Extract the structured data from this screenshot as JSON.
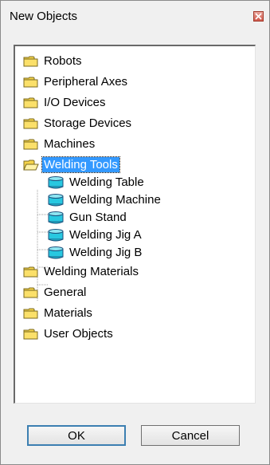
{
  "window": {
    "title": "New Objects",
    "close_icon": "close-icon",
    "accent_close": "#d0574a"
  },
  "tree": {
    "folders": [
      {
        "label": "Robots",
        "icon": "folder-closed-icon"
      },
      {
        "label": "Peripheral Axes",
        "icon": "folder-closed-icon"
      },
      {
        "label": "I/O Devices",
        "icon": "folder-closed-icon"
      },
      {
        "label": "Storage Devices",
        "icon": "folder-closed-icon"
      },
      {
        "label": "Machines",
        "icon": "folder-closed-icon"
      },
      {
        "label": "Welding Tools",
        "icon": "folder-open-icon",
        "selected": true,
        "children": [
          {
            "label": "Welding Table",
            "icon": "object-cylinder-icon"
          },
          {
            "label": "Welding Machine",
            "icon": "object-cylinder-icon"
          },
          {
            "label": "Gun Stand",
            "icon": "object-cylinder-icon"
          },
          {
            "label": "Welding Jig A",
            "icon": "object-cylinder-icon"
          },
          {
            "label": "Welding Jig B",
            "icon": "object-cylinder-icon"
          }
        ]
      },
      {
        "label": "Welding Materials",
        "icon": "folder-closed-icon"
      },
      {
        "label": "General",
        "icon": "folder-closed-icon"
      },
      {
        "label": "Materials",
        "icon": "folder-closed-icon"
      },
      {
        "label": "User Objects",
        "icon": "folder-closed-icon"
      }
    ],
    "selection_color": "#3399ff"
  },
  "buttons": {
    "ok_label": "OK",
    "cancel_label": "Cancel"
  }
}
